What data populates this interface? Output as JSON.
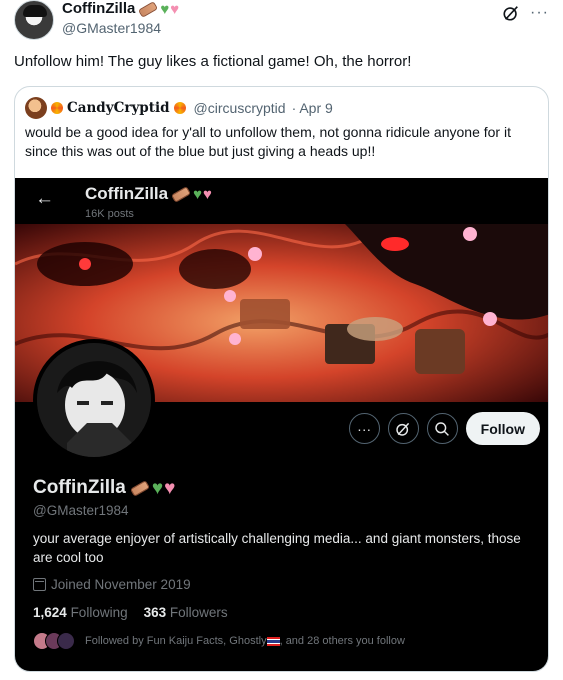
{
  "tweet": {
    "author_name": "CoffinZilla",
    "author_handle": "@GMaster1984",
    "text": "Unfollow him! The guy likes a fictional game! Oh, the horror!",
    "name_emojis": [
      "coffin-icon",
      "green-heart-icon",
      "pink-heart-icon"
    ],
    "actions": [
      "grok-icon",
      "more-icon"
    ]
  },
  "quote": {
    "author_name": "CandyCryptid",
    "author_handle": "@circuscryptid",
    "date": "· Apr 9",
    "text": "would be a good idea for y'all to unfollow them, not gonna ridicule anyone for it since this was out of the blue but just giving a heads up!!"
  },
  "profile_shot": {
    "header_name": "CoffinZilla",
    "posts": "16K posts",
    "display_name": "CoffinZilla",
    "handle": "@GMaster1984",
    "bio": "your average enjoyer of artistically challenging media... and giant monsters, those are cool too",
    "joined": "Joined November 2019",
    "following_count": "1,624",
    "following_label": "Following",
    "followers_count": "363",
    "followers_label": "Followers",
    "followed_by": "Followed by Fun Kaiju Facts, Ghostly",
    "followed_by_suffix": ", and 28 others you follow",
    "follow_button": "Follow",
    "more_button": "···",
    "grok_button": "⌀",
    "search_button": "⌕"
  },
  "colors": {
    "accent_dark_bg": "#000000",
    "follow_button_bg": "#eff3f4",
    "muted_text": "#71767b",
    "green_heart": "#5ab15a",
    "pink_heart": "#f48fb1"
  }
}
